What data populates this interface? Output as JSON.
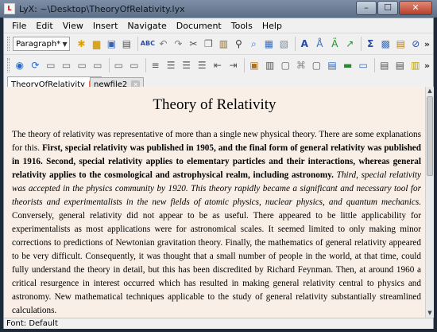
{
  "window": {
    "title": "LyX: ~\\Desktop\\TheoryOfRelativity.lyx",
    "minimize": "–",
    "maximize": "☐",
    "close": "✕"
  },
  "menu": [
    "File",
    "Edit",
    "View",
    "Insert",
    "Navigate",
    "Document",
    "Tools",
    "Help"
  ],
  "toolbar": {
    "paragraph_style": "Paragraph*",
    "more": "»"
  },
  "tabs": [
    {
      "label": "TheoryOfRelativity",
      "active": true
    },
    {
      "label": "newfile2",
      "active": false
    }
  ],
  "document": {
    "title": "Theory of Relativity",
    "p1": "The theory of relativity was representative of more than a single new physical theory. There are some explanations for this. ",
    "p1_bold": "First, special relativity was published in 1905, and the final form of general relativity was published in 1916. Second, special relativity applies to elementary particles and their interactions, whereas general relativity applies to the cosmological and astrophysical realm, including astronomy.",
    "p1_italic": " Third, special relativity was accepted in the physics community by 1920. This theory rapidly became a significant and necessary tool for theorists and experimentalists in the new fields of atomic physics, nuclear physics, and quantum mechanics.",
    "p1_rest": " Conversely, general relativity did not appear to be as useful. There appeared to be little applicability for experimentalists as most applications were for astronomical scales. It seemed limited to only making minor corrections to predictions of Newtonian gravitation theory. Finally, the mathematics of general relativity appeared to be very difficult. Consequently, it was thought that a small number of people in the world, at that time, could fully understand the theory in detail, but this has been discredited by Richard Feynman. Then, at around 1960 a critical resurgence in interest occurred which has resulted in making general relativity central to physics and astronomy. New mathematical techniques applicable to the study of general relativity substantially streamlined calculations."
  },
  "status": "Font: Default"
}
